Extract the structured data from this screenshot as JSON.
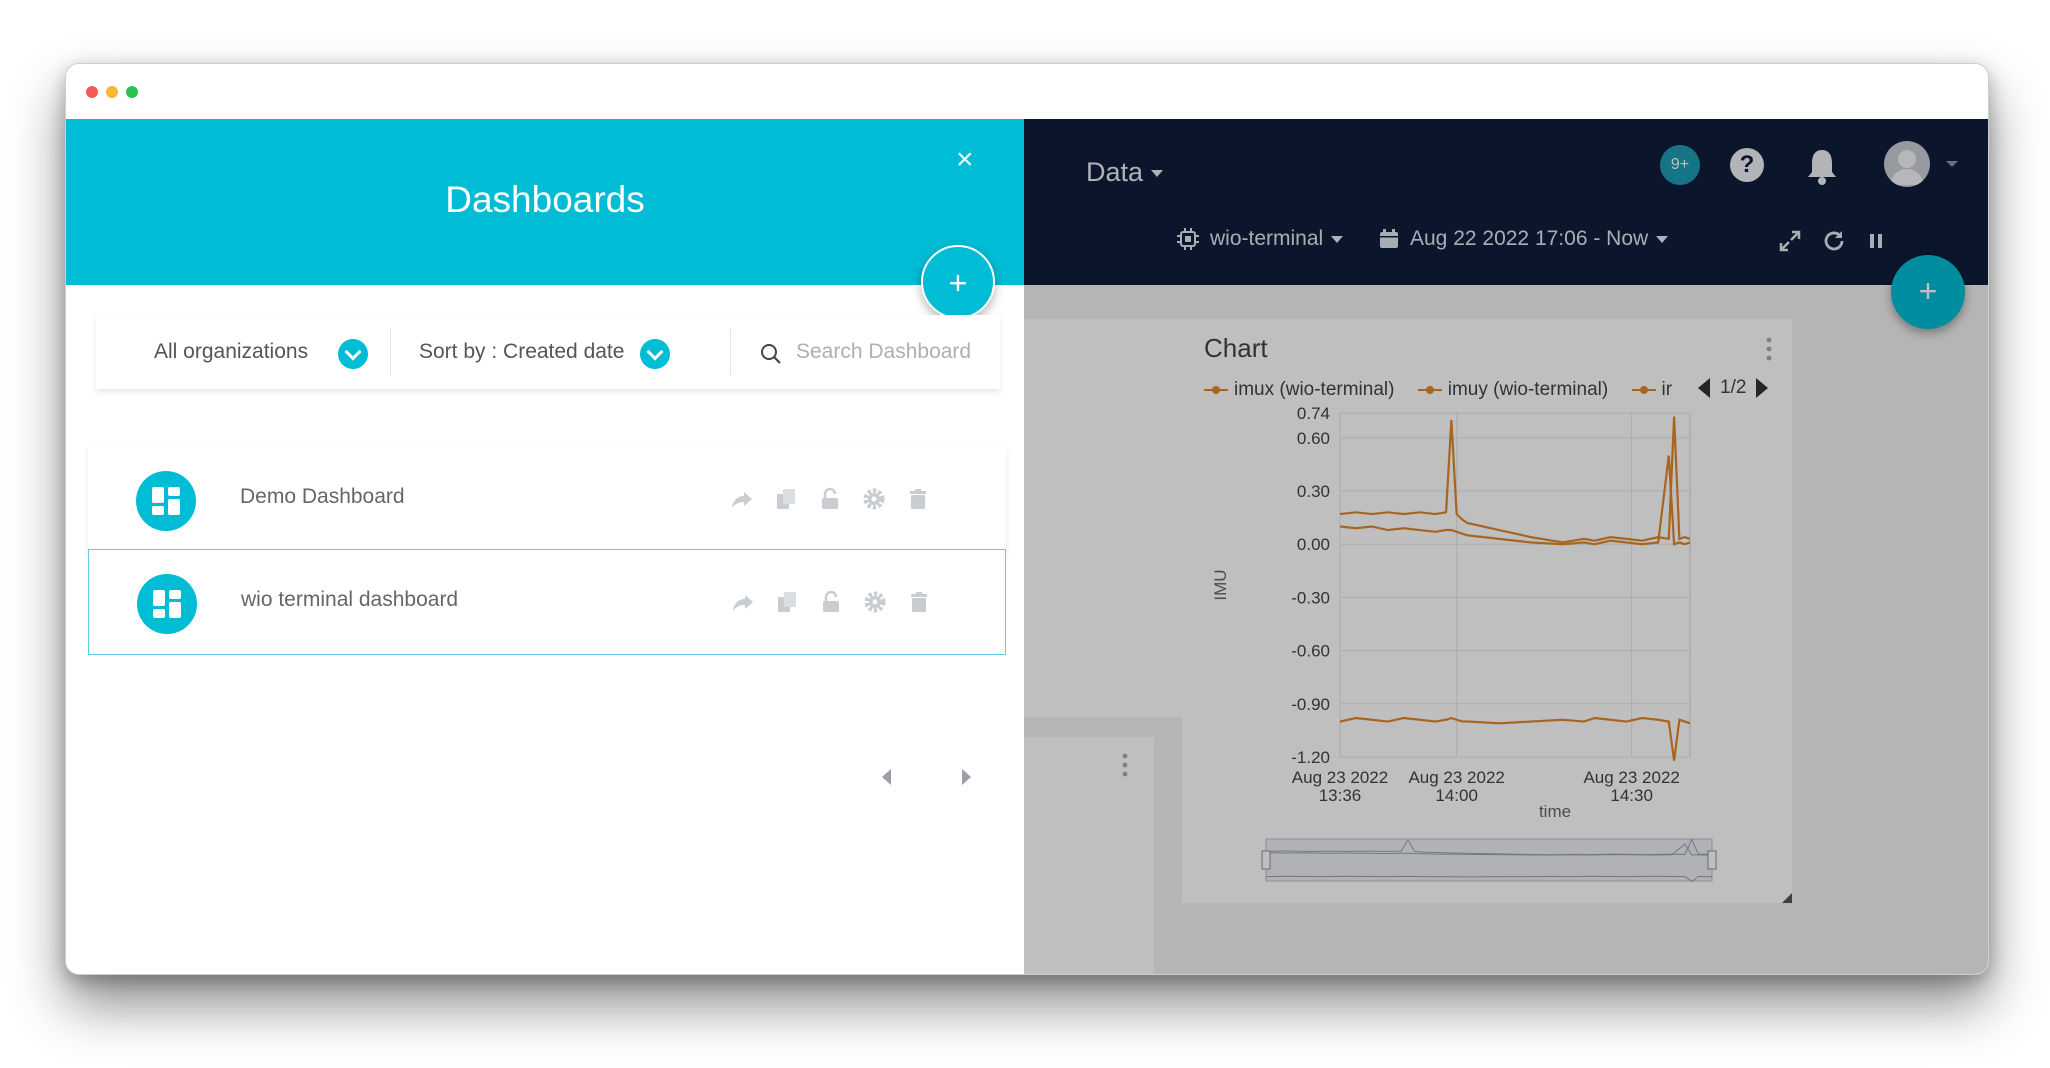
{
  "drawer": {
    "title": "Dashboards",
    "close_symbol": "×",
    "add_symbol": "+",
    "filters": {
      "organization": "All organizations",
      "sort": "Sort by : Created date",
      "search_placeholder": "Search Dashboard"
    },
    "dashboards": [
      {
        "name": "Demo Dashboard"
      },
      {
        "name": "wio terminal dashboard"
      }
    ]
  },
  "topbar": {
    "menu_label": "Data",
    "notification_badge": "9+",
    "help_symbol": "?",
    "device_selector": "wio-terminal",
    "date_range": "Aug 22 2022 17:06 - Now"
  },
  "fab_right_symbol": "+",
  "chart_widget": {
    "title": "Chart",
    "pager": "1/2"
  },
  "chart_data": {
    "type": "line",
    "title": "Chart",
    "xlabel": "time",
    "ylabel": "IMU",
    "ylim": [
      -1.2,
      0.74
    ],
    "yticks": [
      "0.74",
      "0.60",
      "0.30",
      "0.00",
      "-0.30",
      "-0.60",
      "-0.90",
      "-1.20"
    ],
    "xticks": [
      {
        "line1": "Aug 23 2022",
        "line2": "13:36"
      },
      {
        "line1": "Aug 23 2022",
        "line2": "14:00"
      },
      {
        "line1": "Aug 23 2022",
        "line2": "14:30"
      }
    ],
    "x_minutes": [
      0,
      3,
      6,
      9,
      12,
      15,
      18,
      20,
      21,
      22,
      23,
      24,
      30,
      36,
      42,
      46,
      48,
      51,
      54,
      57,
      60,
      62,
      63,
      64,
      65,
      66
    ],
    "series": [
      {
        "name": "imux  (wio-terminal)",
        "values": [
          0.17,
          0.18,
          0.17,
          0.18,
          0.17,
          0.18,
          0.17,
          0.18,
          0.7,
          0.17,
          0.14,
          0.12,
          0.08,
          0.04,
          0.01,
          0.03,
          0.02,
          0.04,
          0.03,
          0.02,
          0.04,
          0.03,
          0.72,
          0.03,
          0.04,
          0.03
        ]
      },
      {
        "name": "imuy  (wio-terminal)",
        "values": [
          0.1,
          0.09,
          0.1,
          0.08,
          0.09,
          0.08,
          0.07,
          0.08,
          0.08,
          0.07,
          0.06,
          0.05,
          0.03,
          0.01,
          0.0,
          0.01,
          0.0,
          0.02,
          0.01,
          0.0,
          0.01,
          0.5,
          0.0,
          0.01,
          0.0,
          0.01
        ]
      },
      {
        "name": "ir",
        "values": [
          -1.0,
          -0.98,
          -0.99,
          -1.0,
          -0.98,
          -0.99,
          -1.0,
          -0.99,
          -0.98,
          -0.99,
          -1.0,
          -1.0,
          -1.01,
          -1.0,
          -0.99,
          -1.0,
          -0.98,
          -0.99,
          -1.0,
          -0.98,
          -0.99,
          -1.0,
          -1.22,
          -0.99,
          -1.0,
          -1.01
        ]
      }
    ],
    "legend_position": "top",
    "grid": true,
    "color": "#e0872a"
  }
}
